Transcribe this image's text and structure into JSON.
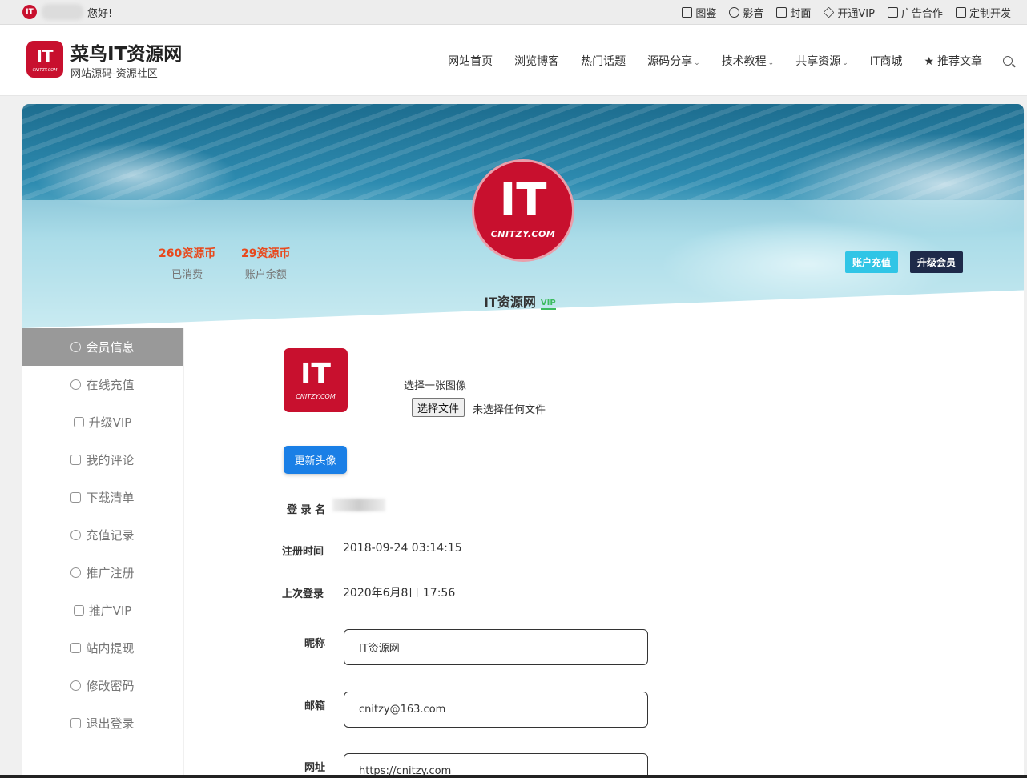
{
  "topbar": {
    "greeting": "您好!",
    "links": [
      "图鉴",
      "影音",
      "封面",
      "开通VIP",
      "广告合作",
      "定制开发"
    ]
  },
  "header": {
    "logo_text": "IT",
    "logo_domain": "CNITZY.COM",
    "title": "菜鸟IT资源网",
    "subtitle": "网站源码-资源社区",
    "nav": [
      {
        "label": "网站首页",
        "dropdown": false
      },
      {
        "label": "浏览博客",
        "dropdown": false
      },
      {
        "label": "热门话题",
        "dropdown": false
      },
      {
        "label": "源码分享",
        "dropdown": true
      },
      {
        "label": "技术教程",
        "dropdown": true
      },
      {
        "label": "共享资源",
        "dropdown": true
      },
      {
        "label": "IT商城",
        "dropdown": false
      },
      {
        "label": "推荐文章",
        "dropdown": false
      }
    ]
  },
  "profile": {
    "avatar_text": "IT",
    "avatar_domain": "CNITZY.COM",
    "spent_value": "260资源币",
    "spent_label": "已消费",
    "balance_value": "29资源币",
    "balance_label": "账户余额",
    "name": "IT资源网",
    "vip_badge": "VIP",
    "recharge_button": "账户充值",
    "upgrade_button": "升级会员"
  },
  "sidebar": {
    "items": [
      {
        "label": "会员信息",
        "active": true
      },
      {
        "label": "在线充值",
        "active": false
      },
      {
        "label": "升级VIP",
        "active": false
      },
      {
        "label": "我的评论",
        "active": false
      },
      {
        "label": "下载清单",
        "active": false
      },
      {
        "label": "充值记录",
        "active": false
      },
      {
        "label": "推广注册",
        "active": false
      },
      {
        "label": "推广VIP",
        "active": false
      },
      {
        "label": "站内提现",
        "active": false
      },
      {
        "label": "修改密码",
        "active": false
      },
      {
        "label": "退出登录",
        "active": false
      }
    ]
  },
  "form": {
    "choose_image_label": "选择一张图像",
    "file_button": "选择文件",
    "file_status": "未选择任何文件",
    "update_avatar_button": "更新头像",
    "login_name_label": "登 录 名",
    "register_time_label": "注册时间",
    "register_time_value": "2018-09-24 03:14:15",
    "last_login_label": "上次登录",
    "last_login_value": "2020年6月8日 17:56",
    "nickname_label": "昵称",
    "nickname_value": "IT资源网",
    "email_label": "邮箱",
    "email_value": "cnitzy@163.com",
    "website_label": "网址",
    "website_value": "https://cnitzy.com"
  },
  "colors": {
    "brand_red": "#c8102e",
    "accent_orange": "#e8491d",
    "recharge_cyan": "#30c5e6",
    "upgrade_navy": "#1e2a4a",
    "update_blue": "#1a7fe6",
    "vip_green": "#3cbc5f"
  }
}
